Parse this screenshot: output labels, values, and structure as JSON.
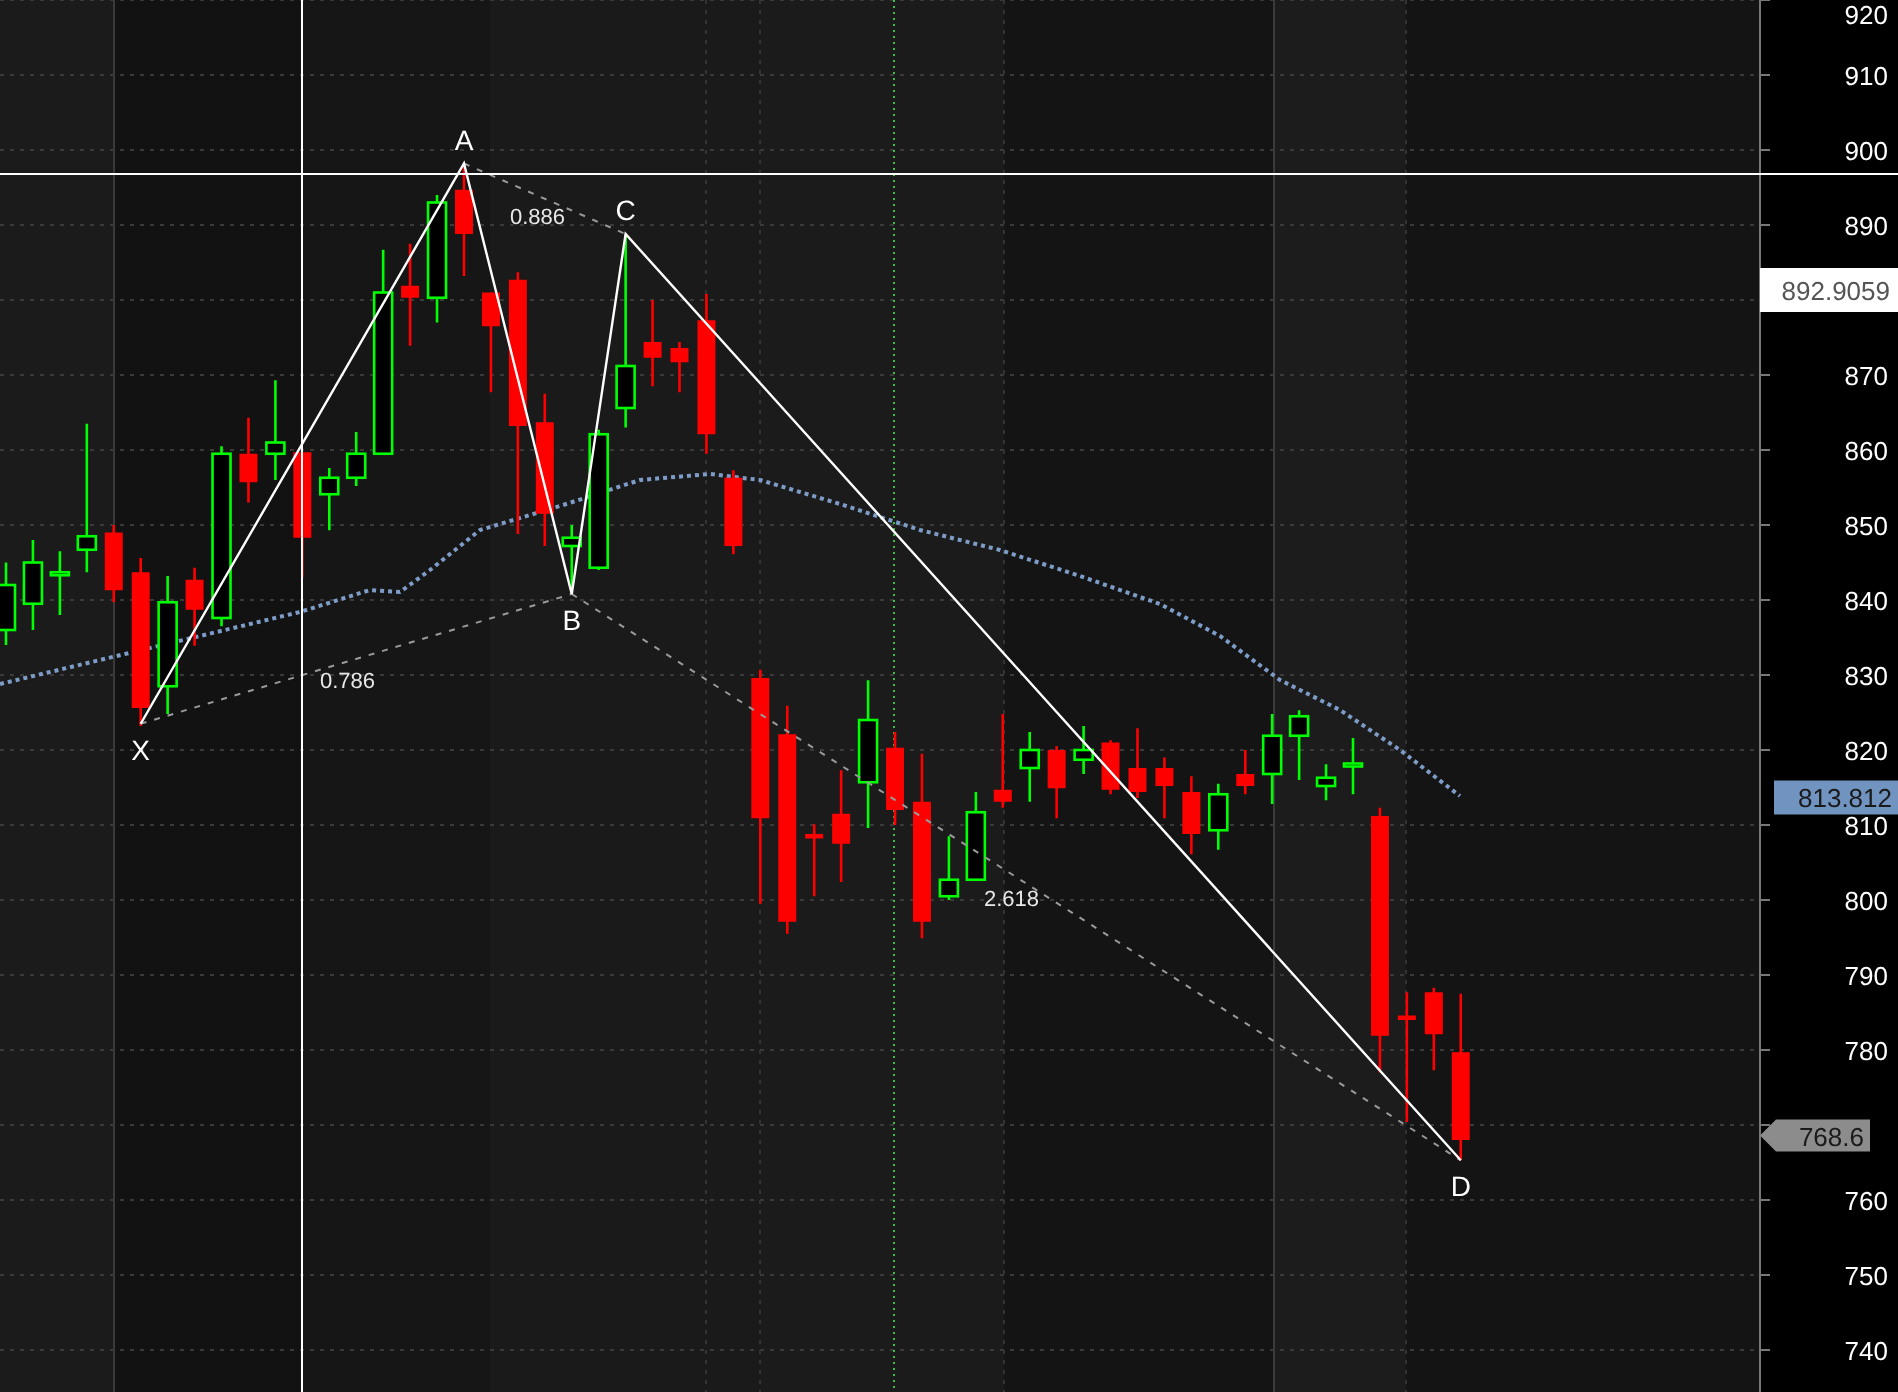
{
  "chart": {
    "pattern_points": [
      {
        "label": "X"
      },
      {
        "label": "A"
      },
      {
        "label": "B"
      },
      {
        "label": "C"
      },
      {
        "label": "D"
      }
    ],
    "ratios": [
      {
        "label": "0.786"
      },
      {
        "label": "0.886"
      },
      {
        "label": "2.618"
      }
    ],
    "price_axis": [
      "920",
      "910",
      "900",
      "890",
      "870",
      "860",
      "850",
      "840",
      "830",
      "820",
      "810",
      "800",
      "790",
      "780",
      "760",
      "750",
      "740"
    ],
    "price_tags": [
      {
        "kind": "crosshair",
        "text": "892.9059"
      },
      {
        "kind": "average",
        "text": "813.812"
      },
      {
        "kind": "last",
        "text": "768.6"
      }
    ]
  }
}
